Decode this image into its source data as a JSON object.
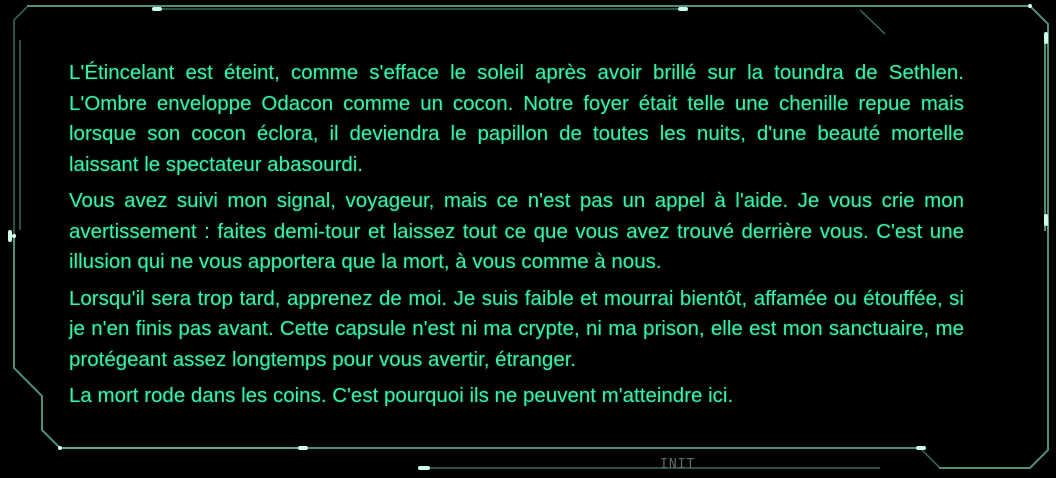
{
  "dialog": {
    "paragraphs": [
      "L'Étincelant est éteint, comme s'efface le soleil après avoir brillé sur la toundra de Sethlen. L'Ombre enveloppe Odacon comme un cocon. Notre foyer était telle une chenille repue mais lorsque son cocon éclora, il deviendra le papillon de toutes les nuits, d'une beauté mortelle laissant le spectateur abasourdi.",
      "Vous avez suivi mon signal, voyageur, mais ce n'est pas un appel à l'aide. Je vous crie mon avertissement : faites demi-tour et laissez tout ce que vous avez trouvé derrière vous. C'est une illusion qui ne vous apportera que la mort, à vous comme à nous.",
      "Lorsqu'il sera trop tard, apprenez de moi. Je suis faible et mourrai bientôt, affamée ou étouffée, si je n'en finis pas avant. Cette capsule n'est ni ma crypte, ni ma prison, elle est mon sanctuaire, me protégeant assez longtemps pour vous avertir, étranger.",
      "La mort rode dans les coins. C'est pourquoi ils ne peuvent m'atteindre ici."
    ],
    "status_label": "INIT"
  },
  "colors": {
    "background": "#000000",
    "text": "#3bf0a9",
    "frame": "#5fa98a",
    "frame_highlight": "#c9ffe9",
    "status_label": "#5c6f67"
  }
}
